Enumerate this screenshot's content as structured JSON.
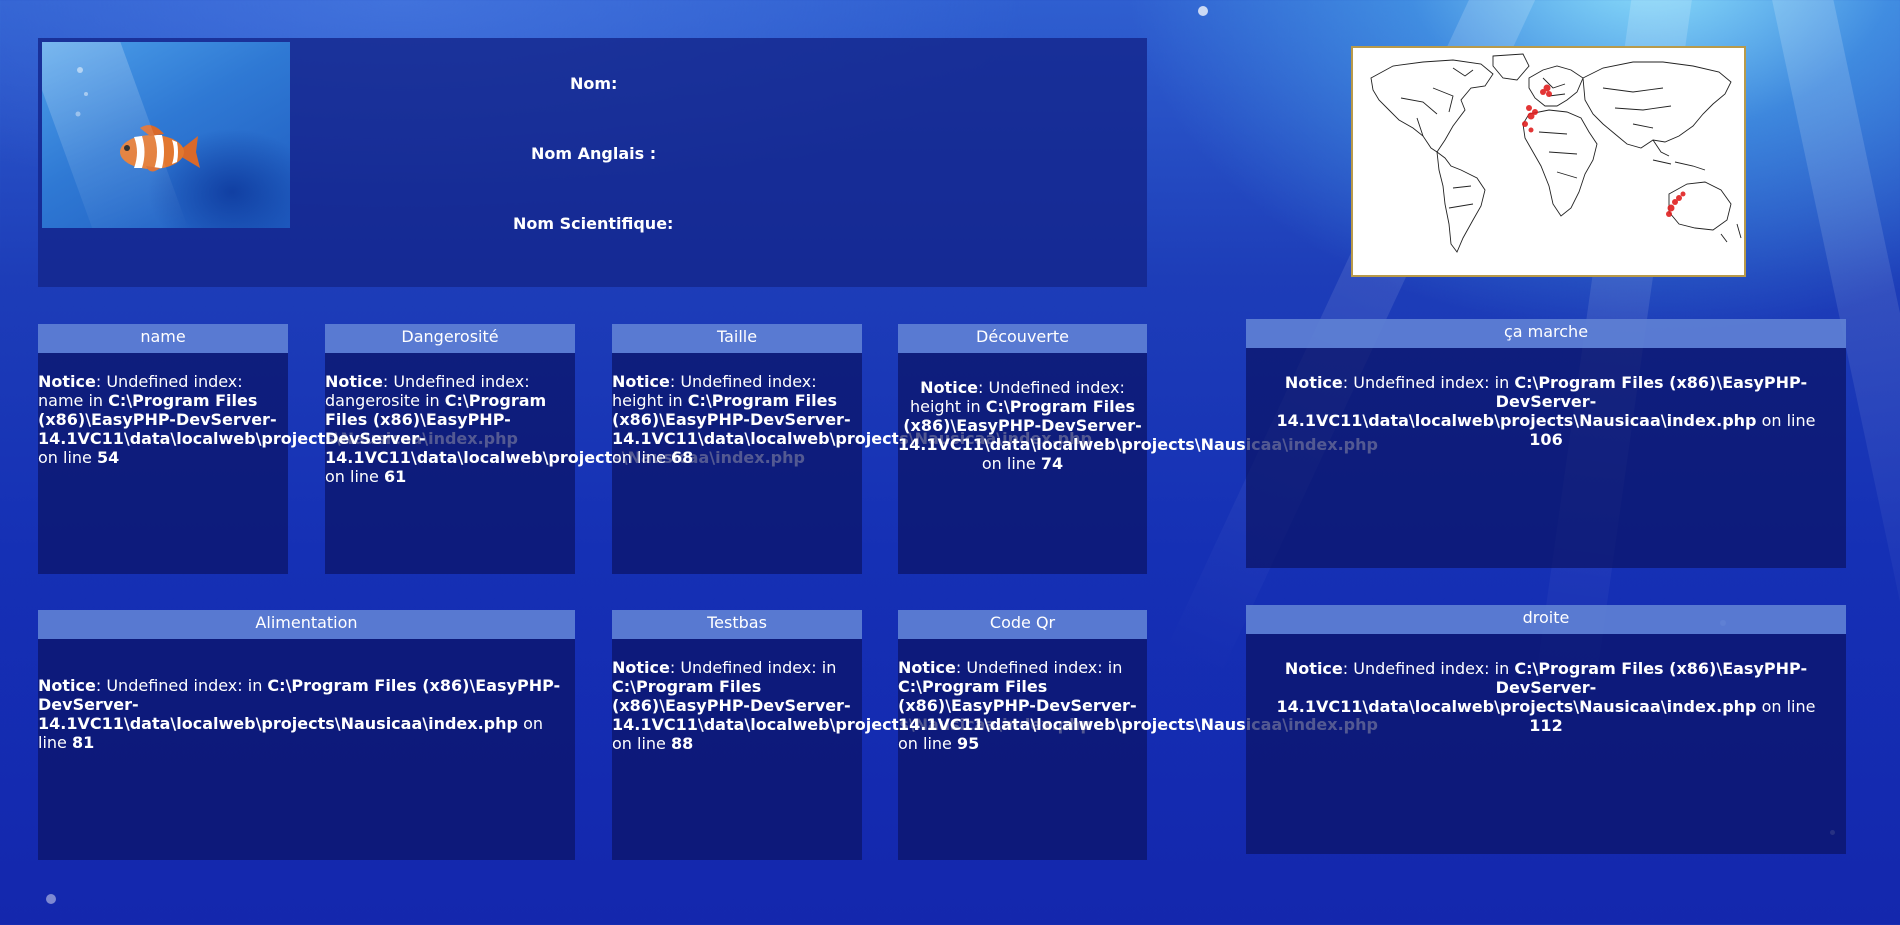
{
  "header": {
    "labels": {
      "nom": "Nom:",
      "nom_anglais": "Nom Anglais :",
      "nom_scientifique": "Nom Scientifique:"
    }
  },
  "boxes": [
    {
      "id": "name",
      "title": "name",
      "notice_label": "Notice",
      "message": ": Undefined index: name in ",
      "path": "C:\\Program Files (x86)\\EasyPHP-DevServer-14.1VC11\\data\\localweb\\projects\\Nausicaa\\index.php",
      "line_text": " on line ",
      "line": "54"
    },
    {
      "id": "dangerosite",
      "title": "Dangerosité",
      "notice_label": "Notice",
      "message": ": Undefined index: dangerosite in ",
      "path": "C:\\Program Files (x86)\\EasyPHP-DevServer-14.1VC11\\data\\localweb\\projects\\Nausicaa\\index.php",
      "line_text": " on line ",
      "line": "61"
    },
    {
      "id": "taille",
      "title": "Taille",
      "notice_label": "Notice",
      "message": ": Undefined index: height in ",
      "path": "C:\\Program Files (x86)\\EasyPHP-DevServer-14.1VC11\\data\\localweb\\projects\\Nausicaa\\index.php",
      "line_text": " on line ",
      "line": "68"
    },
    {
      "id": "decouverte",
      "title": "Découverte",
      "notice_label": "Notice",
      "message": ": Undefined index: height in ",
      "path": "C:\\Program Files (x86)\\EasyPHP-DevServer-14.1VC11\\data\\localweb\\projects\\Nausicaa\\index.php",
      "line_text": " on line ",
      "line": "74"
    },
    {
      "id": "ca_marche",
      "title": "ça marche",
      "notice_label": "Notice",
      "message": ": Undefined index: in ",
      "path": "C:\\Program Files (x86)\\EasyPHP-DevServer-14.1VC11\\data\\localweb\\projects\\Nausicaa\\index.php",
      "line_text": " on line ",
      "line": "106"
    },
    {
      "id": "alimentation",
      "title": "Alimentation",
      "notice_label": "Notice",
      "message": ": Undefined index: in ",
      "path": "C:\\Program Files (x86)\\EasyPHP-DevServer-14.1VC11\\data\\localweb\\projects\\Nausicaa\\index.php",
      "line_text": " on line ",
      "line": "81"
    },
    {
      "id": "testbas",
      "title": "Testbas",
      "notice_label": "Notice",
      "message": ": Undefined index: in ",
      "path": "C:\\Program Files (x86)\\EasyPHP-DevServer-14.1VC11\\data\\localweb\\projects\\Nausicaa\\index.php",
      "line_text": " on line ",
      "line": "88"
    },
    {
      "id": "code_qr",
      "title": "Code Qr",
      "notice_label": "Notice",
      "message": ": Undefined index: in ",
      "path": "C:\\Program Files (x86)\\EasyPHP-DevServer-14.1VC11\\data\\localweb\\projects\\Nausicaa\\index.php",
      "line_text": " on line ",
      "line": "95"
    },
    {
      "id": "droite",
      "title": "droite",
      "notice_label": "Notice",
      "message": ": Undefined index: in ",
      "path": "C:\\Program Files (x86)\\EasyPHP-DevServer-14.1VC11\\data\\localweb\\projects\\Nausicaa\\index.php",
      "line_text": " on line ",
      "line": "112"
    }
  ],
  "colors": {
    "header_bar": "#5e80d4",
    "panel": "#0c166e",
    "map_marker": "#e02020"
  },
  "icons": {
    "fish_image": "clownfish-image",
    "map_image": "world-map-image"
  }
}
